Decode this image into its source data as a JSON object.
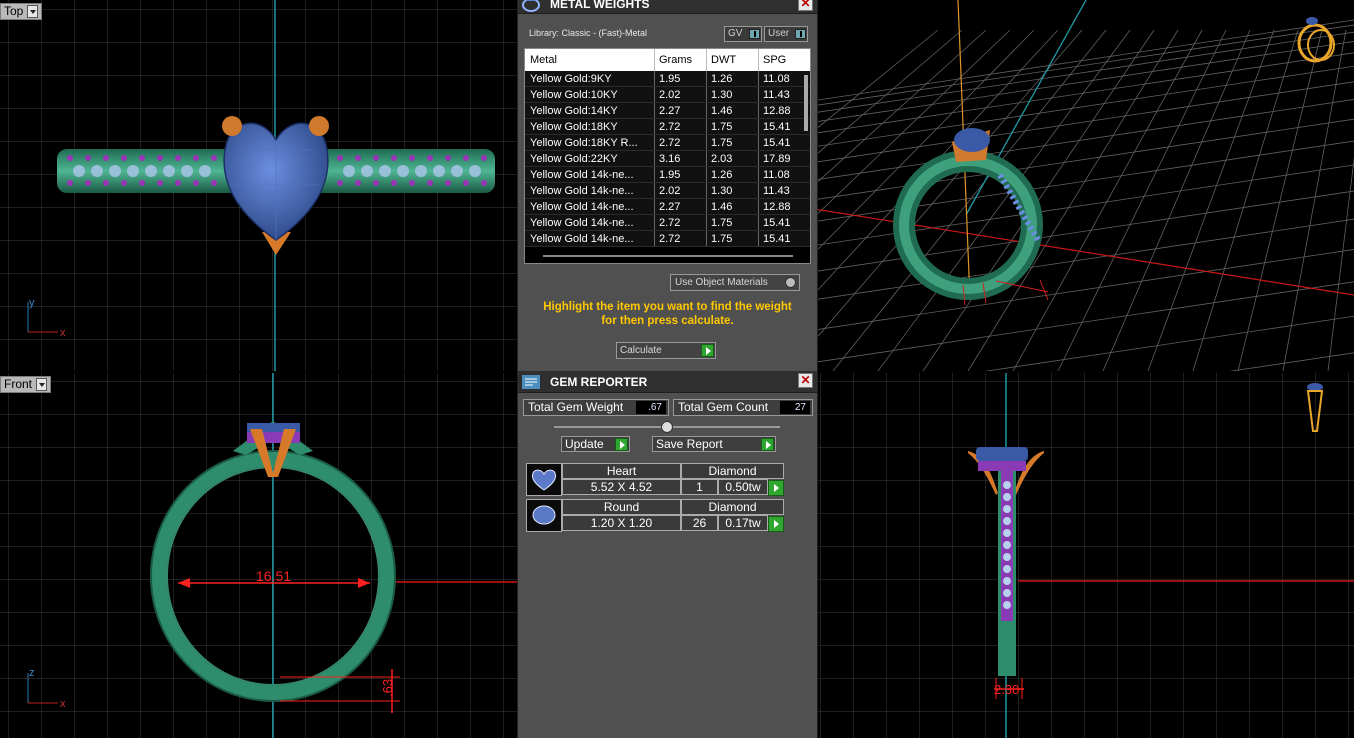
{
  "viewports": {
    "top": {
      "label": "Top",
      "axis_a": "y",
      "axis_b": "x"
    },
    "front": {
      "label": "Front",
      "axis_a": "z",
      "axis_b": "x",
      "dim_width": "16.51",
      "dim_height": ".63"
    },
    "side": {
      "dim_width": "2.30"
    }
  },
  "metal_weights": {
    "title": "METAL WEIGHTS",
    "library": "Library: Classic - (Fast)-Metal",
    "toggle_gv": "GV",
    "toggle_user": "User",
    "columns": [
      "Metal",
      "Grams",
      "DWT",
      "SPG"
    ],
    "rows": [
      [
        "Yellow Gold:9KY",
        "1.95",
        "1.26",
        "11.08"
      ],
      [
        "Yellow Gold:10KY",
        "2.02",
        "1.30",
        "11.43"
      ],
      [
        "Yellow Gold:14KY",
        "2.27",
        "1.46",
        "12.88"
      ],
      [
        "Yellow Gold:18KY",
        "2.72",
        "1.75",
        "15.41"
      ],
      [
        "Yellow Gold:18KY R...",
        "2.72",
        "1.75",
        "15.41"
      ],
      [
        "Yellow Gold:22KY",
        "3.16",
        "2.03",
        "17.89"
      ],
      [
        "Yellow Gold 14k-ne...",
        "1.95",
        "1.26",
        "11.08"
      ],
      [
        "Yellow Gold 14k-ne...",
        "2.02",
        "1.30",
        "11.43"
      ],
      [
        "Yellow Gold 14k-ne...",
        "2.27",
        "1.46",
        "12.88"
      ],
      [
        "Yellow Gold 14k-ne...",
        "2.72",
        "1.75",
        "15.41"
      ],
      [
        "Yellow Gold 14k-ne...",
        "2.72",
        "1.75",
        "15.41"
      ]
    ],
    "use_object_materials": "Use Object Materials",
    "hint_line1": "Highlight the item you want to find the weight",
    "hint_line2": "for then press calculate.",
    "calculate": "Calculate"
  },
  "gem_reporter": {
    "title": "GEM REPORTER",
    "total_weight_label": "Total Gem Weight",
    "total_weight_value": ".67",
    "total_count_label": "Total Gem Count",
    "total_count_value": "27",
    "update": "Update",
    "save_report": "Save Report",
    "gems": [
      {
        "shape": "Heart",
        "size": "5.52 X 4.52",
        "material": "Diamond",
        "count": "1",
        "weight": "0.50tw"
      },
      {
        "shape": "Round",
        "size": "1.20 X 1.20",
        "material": "Diamond",
        "count": "26",
        "weight": "0.17tw"
      }
    ]
  },
  "colors": {
    "ring_band": "#2e8d6c",
    "gem": "#3a5aa8",
    "prong": "#d67a2a",
    "grid": "#3a3a3a",
    "dimension": "#ff2020",
    "hint_text": "#ffc800"
  }
}
